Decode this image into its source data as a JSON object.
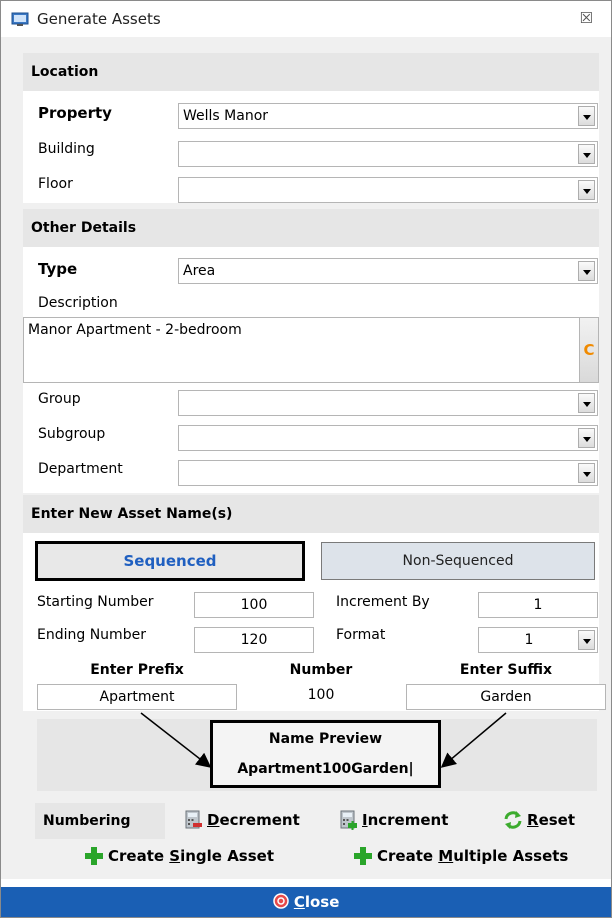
{
  "window": {
    "title": "Generate Assets",
    "close_glyph": "☒"
  },
  "location": {
    "header": "Location",
    "property": {
      "label": "Property",
      "value": "Wells Manor"
    },
    "building": {
      "label": "Building",
      "value": ""
    },
    "floor": {
      "label": "Floor",
      "value": ""
    }
  },
  "other_details": {
    "header": "Other Details",
    "type": {
      "label": "Type",
      "value": "Area"
    },
    "description": {
      "label": "Description",
      "value": "Manor Apartment - 2-bedroom",
      "button": "C"
    },
    "group": {
      "label": "Group",
      "value": ""
    },
    "subgroup": {
      "label": "Subgroup",
      "value": ""
    },
    "department": {
      "label": "Department",
      "value": ""
    }
  },
  "asset_names": {
    "header": "Enter New Asset Name(s)",
    "sequenced_label": "Sequenced",
    "non_sequenced_label": "Non-Sequenced",
    "starting_number": {
      "label": "Starting Number",
      "value": "100"
    },
    "ending_number": {
      "label": "Ending Number",
      "value": "120"
    },
    "increment_by": {
      "label": "Increment By",
      "value": "1"
    },
    "format": {
      "label": "Format",
      "value": "1"
    },
    "prefix": {
      "label": "Enter Prefix",
      "value": "Apartment"
    },
    "number": {
      "label": "Number",
      "value": "100"
    },
    "suffix": {
      "label": "Enter Suffix",
      "value": "Garden"
    },
    "preview": {
      "label": "Name Preview",
      "value": "Apartment100Garden|"
    }
  },
  "numbering": {
    "label": "Numbering",
    "decrement": {
      "first": "D",
      "rest": "ecrement",
      "icon": "calculator-minus-icon"
    },
    "increment": {
      "first": "I",
      "rest": "ncrement",
      "icon": "calculator-plus-icon"
    },
    "reset": {
      "first": "R",
      "rest": "eset",
      "icon": "refresh-icon"
    }
  },
  "create": {
    "single": {
      "pre": "Create ",
      "u": "S",
      "post": "ingle Asset"
    },
    "multiple": {
      "pre": "Create ",
      "u": "M",
      "post": "ultiple Assets"
    }
  },
  "footer": {
    "close_first": "C",
    "close_rest": "lose"
  },
  "colors": {
    "accent": "#1a5fb4",
    "sequenced_text": "#1f5fc0",
    "footer_bg": "#1a5fb4",
    "plus_green": "#2aa52a"
  }
}
